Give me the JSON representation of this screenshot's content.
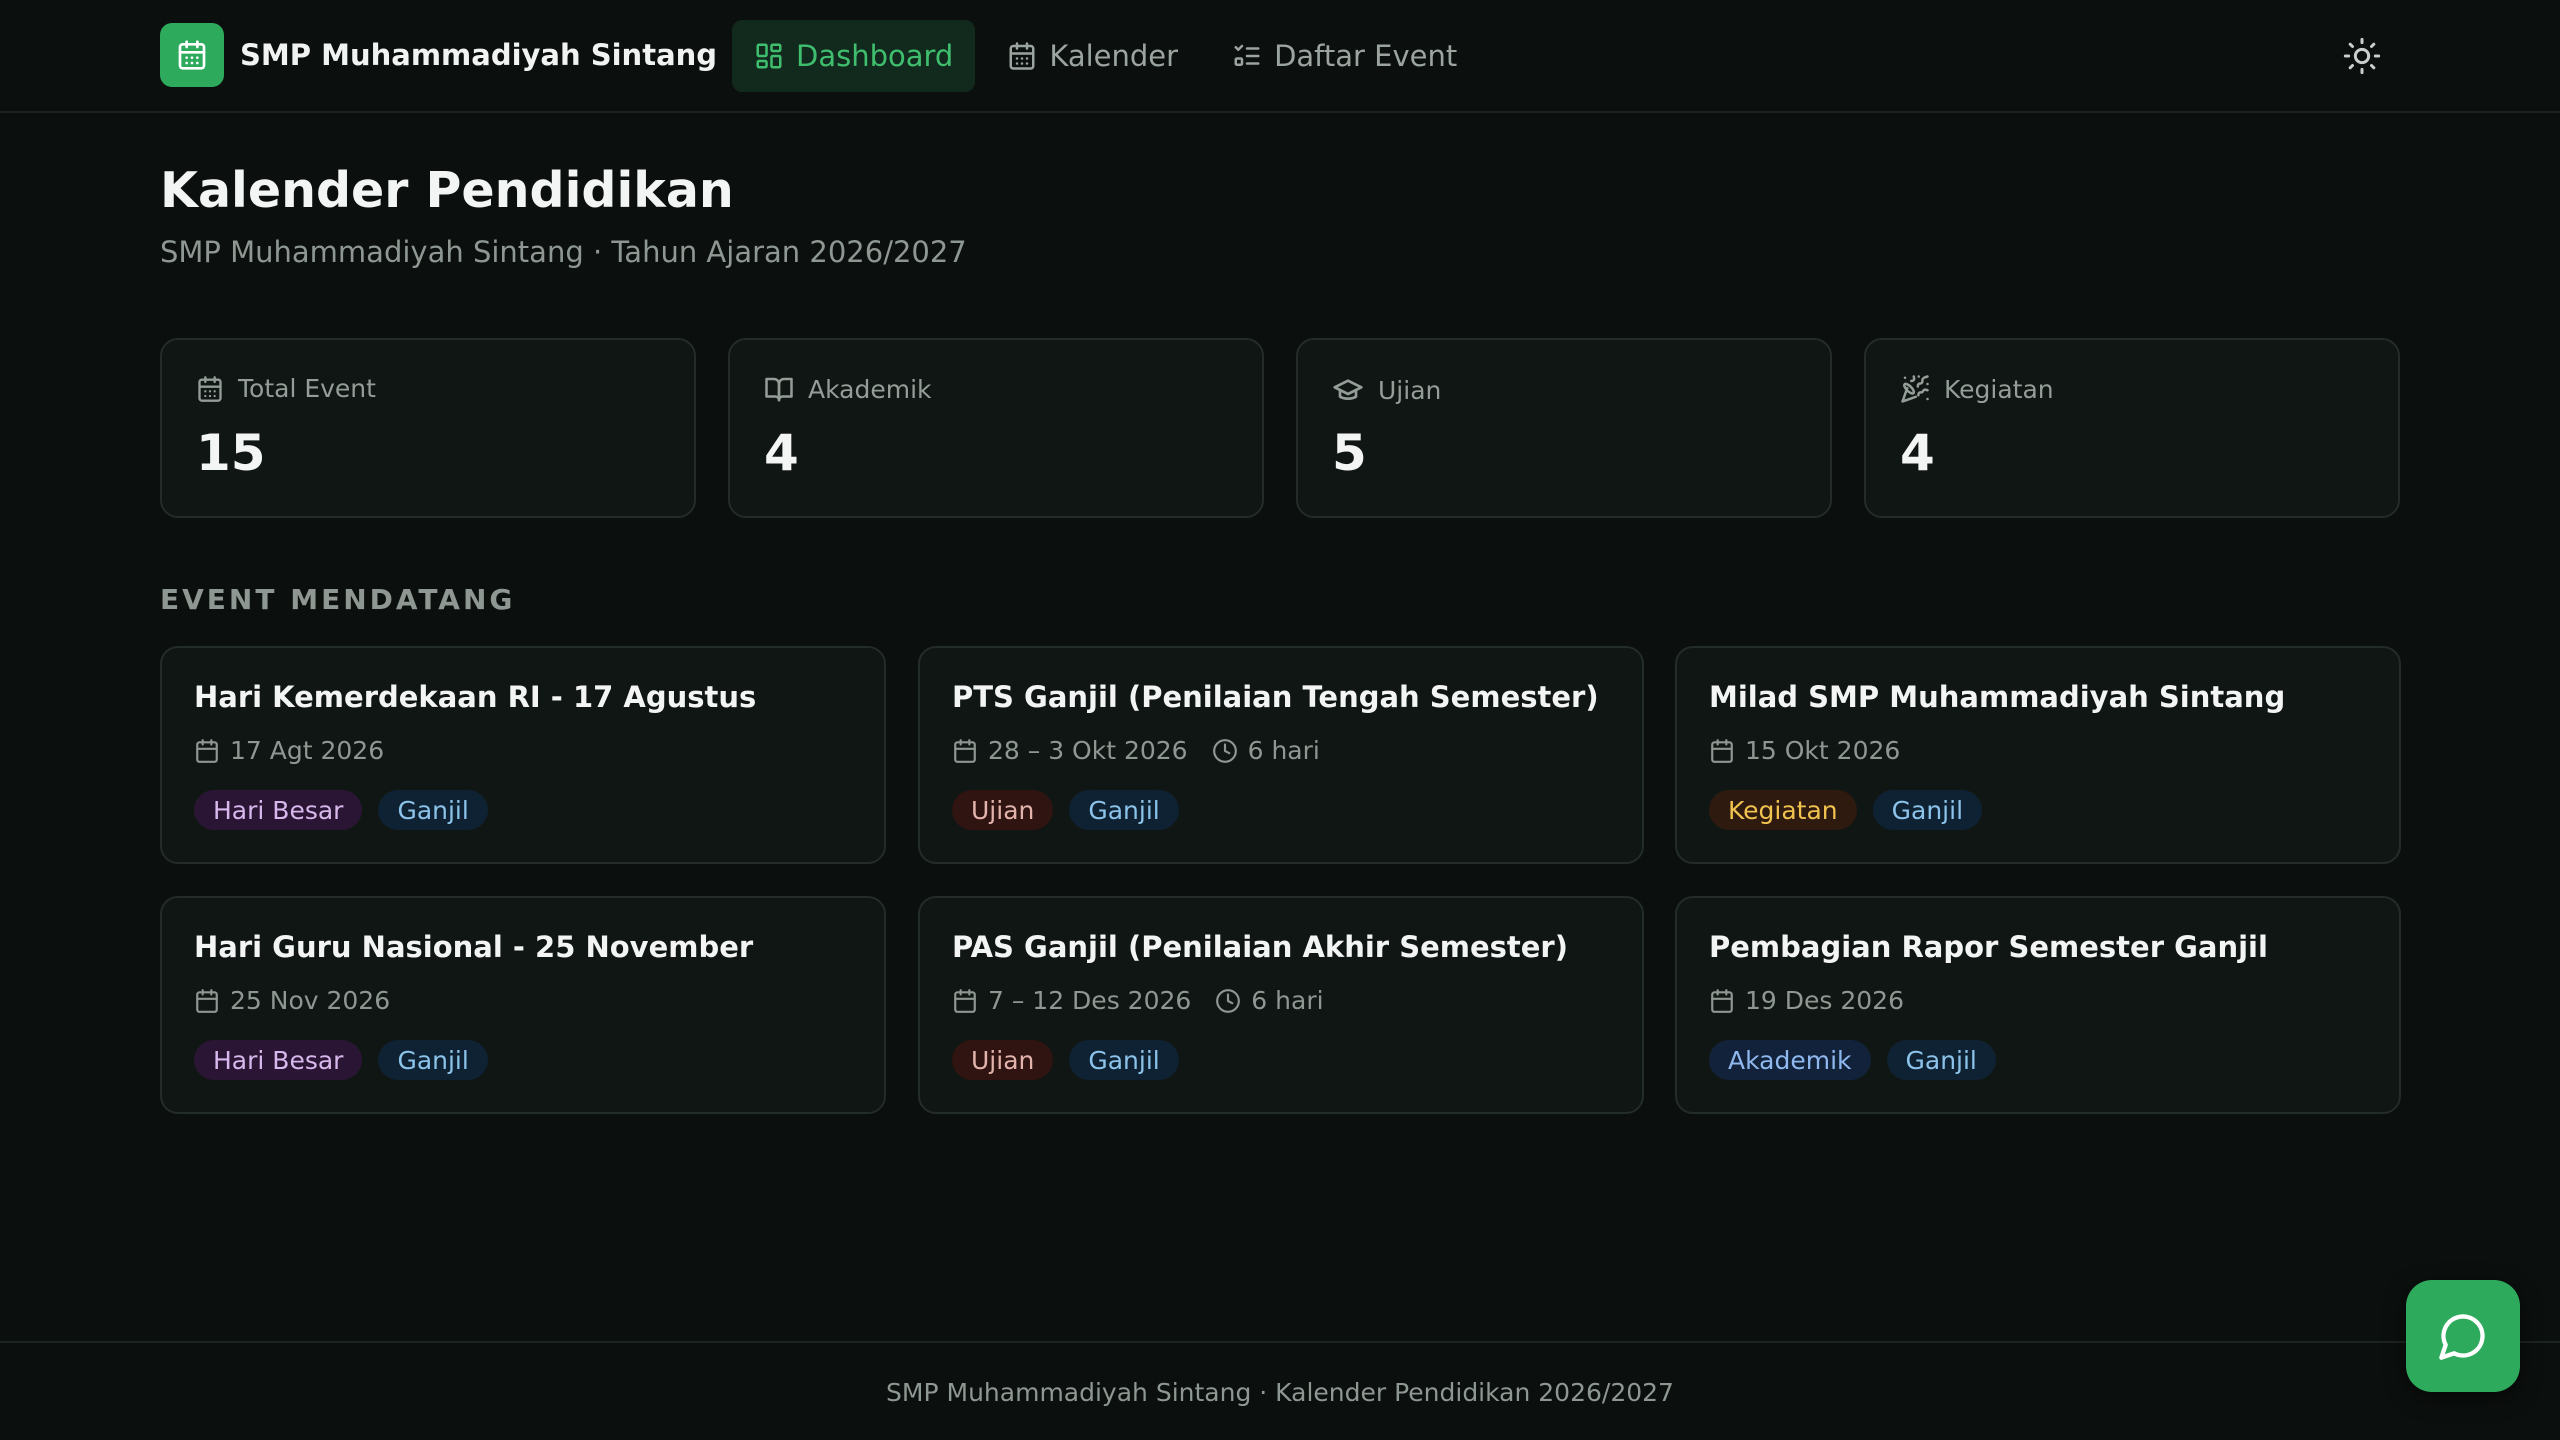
{
  "app": {
    "name": "SMP Muhammadiyah Sintang",
    "logo_icon": "calendar-icon"
  },
  "colors": {
    "background": "#0b0f0d",
    "card": "#101613",
    "accent": "#2eaa5c",
    "active_nav_text": "#3fbf6e",
    "active_nav_bg": "#122a1e"
  },
  "nav": {
    "items": [
      {
        "label": "Dashboard",
        "icon": "dashboard-grid-icon",
        "active": true
      },
      {
        "label": "Kalender",
        "icon": "calendar-icon",
        "active": false
      },
      {
        "label": "Daftar Event",
        "icon": "checklist-icon",
        "active": false
      }
    ],
    "theme_toggle_icon": "sun-icon"
  },
  "header": {
    "title": "Kalender Pendidikan",
    "subtitle": "SMP Muhammadiyah Sintang · Tahun Ajaran 2026/2027"
  },
  "stats": [
    {
      "label": "Total Event",
      "value": "15",
      "icon": "calendar-icon"
    },
    {
      "label": "Akademik",
      "value": "4",
      "icon": "book-icon"
    },
    {
      "label": "Ujian",
      "value": "5",
      "icon": "graduation-cap-icon"
    },
    {
      "label": "Kegiatan",
      "value": "4",
      "icon": "party-popper-icon"
    }
  ],
  "upcoming": {
    "title": "EVENT MENDATANG",
    "events": [
      {
        "title": "Hari Kemerdekaan RI - 17 Agustus",
        "date": "17 Agt 2026",
        "duration": "",
        "tags": [
          {
            "label": "Hari Besar",
            "kind": "hari-besar"
          },
          {
            "label": "Ganjil",
            "kind": "ganjil"
          }
        ]
      },
      {
        "title": "PTS Ganjil (Penilaian Tengah Semester)",
        "date": "28 – 3 Okt 2026",
        "duration": "6 hari",
        "tags": [
          {
            "label": "Ujian",
            "kind": "ujian"
          },
          {
            "label": "Ganjil",
            "kind": "ganjil"
          }
        ]
      },
      {
        "title": "Milad SMP Muhammadiyah Sintang",
        "date": "15 Okt 2026",
        "duration": "",
        "tags": [
          {
            "label": "Kegiatan",
            "kind": "kegiatan"
          },
          {
            "label": "Ganjil",
            "kind": "ganjil"
          }
        ]
      },
      {
        "title": "Hari Guru Nasional - 25 November",
        "date": "25 Nov 2026",
        "duration": "",
        "tags": [
          {
            "label": "Hari Besar",
            "kind": "hari-besar"
          },
          {
            "label": "Ganjil",
            "kind": "ganjil"
          }
        ]
      },
      {
        "title": "PAS Ganjil (Penilaian Akhir Semester)",
        "date": "7 – 12 Des 2026",
        "duration": "6 hari",
        "tags": [
          {
            "label": "Ujian",
            "kind": "ujian"
          },
          {
            "label": "Ganjil",
            "kind": "ganjil"
          }
        ]
      },
      {
        "title": "Pembagian Rapor Semester Ganjil",
        "date": "19 Des 2026",
        "duration": "",
        "tags": [
          {
            "label": "Akademik",
            "kind": "akademik"
          },
          {
            "label": "Ganjil",
            "kind": "ganjil"
          }
        ]
      }
    ]
  },
  "tag_colors": {
    "hari-besar": {
      "bg": "#2a1634",
      "fg": "#d7b7ec"
    },
    "ganjil": {
      "bg": "#0f2233",
      "fg": "#8cc3ea"
    },
    "ujian": {
      "bg": "#2f1412",
      "fg": "#e2b3ab"
    },
    "kegiatan": {
      "bg": "#2e1a0f",
      "fg": "#f0c24f"
    },
    "akademik": {
      "bg": "#12223a",
      "fg": "#8fb8ee"
    }
  },
  "footer": {
    "text": "SMP Muhammadiyah Sintang · Kalender Pendidikan 2026/2027"
  },
  "chat_button": {
    "icon": "chat-bubble-icon"
  }
}
